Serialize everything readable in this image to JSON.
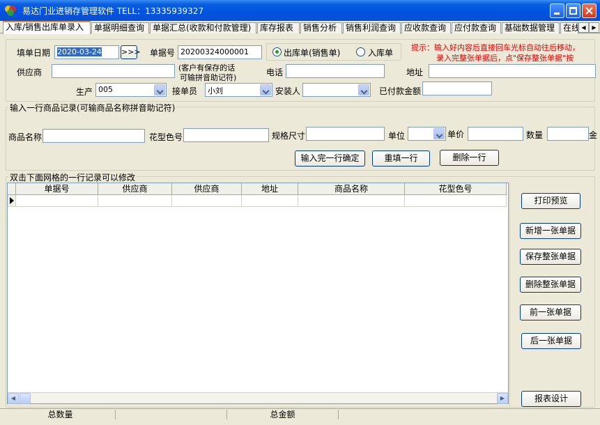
{
  "window": {
    "title": "易达门业进销存管理软件 TELL：13335939327",
    "icon": "app-logo-icon",
    "accent": "#0a5fe0"
  },
  "tabs": [
    {
      "label": "入库/销售出库单录入",
      "active": true
    },
    {
      "label": "单据明细查询"
    },
    {
      "label": "单据汇总(收款和付款管理)"
    },
    {
      "label": "库存报表"
    },
    {
      "label": "销售分析"
    },
    {
      "label": "销售利润查询"
    },
    {
      "label": "应收款查询"
    },
    {
      "label": "应付款查询"
    },
    {
      "label": "基础数据管理"
    },
    {
      "label": "在线"
    }
  ],
  "form": {
    "date_label": "填单日期",
    "date_value": "2020-03-24",
    "date_picker_label": ">>>",
    "bill_no_label": "单据号",
    "bill_no_value": "20200324000001",
    "radio_out_label": "出库单(销售单)",
    "radio_in_label": "入库单",
    "hint_line1": "提示：输入好内容后直接回车光标自动往后移动，",
    "hint_line2": "录入完整张单据后，点\"保存整张单据\"按",
    "hint_color": "#e00000",
    "supplier_label": "供应商",
    "supplier_note_line1": "(客户有保存的话",
    "supplier_note_line2": "可输拼音助记符)",
    "phone_label": "电话",
    "address_label": "地址",
    "production_label": "生产",
    "production_value": "005",
    "receiver_label": "接单员",
    "receiver_value": "小刘",
    "installer_label": "安装人",
    "paid_label": "已付款金额"
  },
  "line_entry": {
    "group_title": "输入一行商品记录(可输商品名称拼音助记符)",
    "product_name_label": "商品名称",
    "color_label": "花型色号",
    "spec_label": "规格尺寸",
    "unit_label": "单位",
    "price_label": "单价",
    "qty_label": "数量",
    "amount_label": "金",
    "confirm_button": "输入完一行确定",
    "refill_button": "重填一行",
    "delete_row_button": "删除一行"
  },
  "grid": {
    "group_title": "双击下面网格的一行记录可以修改",
    "columns": [
      "单据号",
      "供应商",
      "供应商",
      "地址",
      "商品名称",
      "花型色号"
    ]
  },
  "actions": {
    "print_preview": "打印预览",
    "new_bill": "新增一张单据",
    "save_bill": "保存整张单据",
    "delete_bill": "删除整张单据",
    "prev_bill": "前一张单据",
    "next_bill": "后一张单据",
    "report_design": "报表设计"
  },
  "status": {
    "total_qty_label": "总数量",
    "total_amount_label": "总金额"
  }
}
